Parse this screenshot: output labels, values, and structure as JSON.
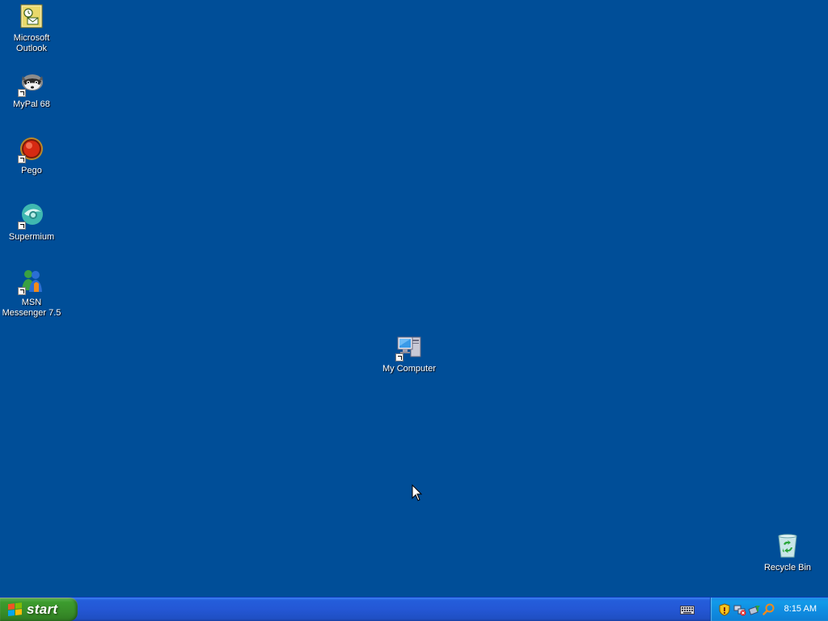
{
  "desktop": {
    "background_color": "#004e98",
    "icons": [
      {
        "label": "Microsoft\nOutlook",
        "icon": "outlook-icon"
      },
      {
        "label": "MyPal 68",
        "icon": "mypal-icon"
      },
      {
        "label": "Pego",
        "icon": "pego-icon"
      },
      {
        "label": "Supermium",
        "icon": "supermium-icon"
      },
      {
        "label": "MSN\nMessenger 7.5",
        "icon": "msn-messenger-icon"
      },
      {
        "label": "My Computer",
        "icon": "my-computer-icon"
      },
      {
        "label": "Recycle Bin",
        "icon": "recycle-bin-icon"
      }
    ]
  },
  "taskbar": {
    "start_label": "start",
    "quick_icons": [
      "keyboard-icon"
    ],
    "tray_icons": [
      "security-shield-icon",
      "network-disconnected-icon",
      "safely-remove-hardware-icon",
      "search-icon"
    ],
    "clock": "8:15 AM",
    "colors": {
      "taskbar": "#245edb",
      "start_button": "#3c9c2e",
      "tray": "#0f8be0"
    }
  }
}
